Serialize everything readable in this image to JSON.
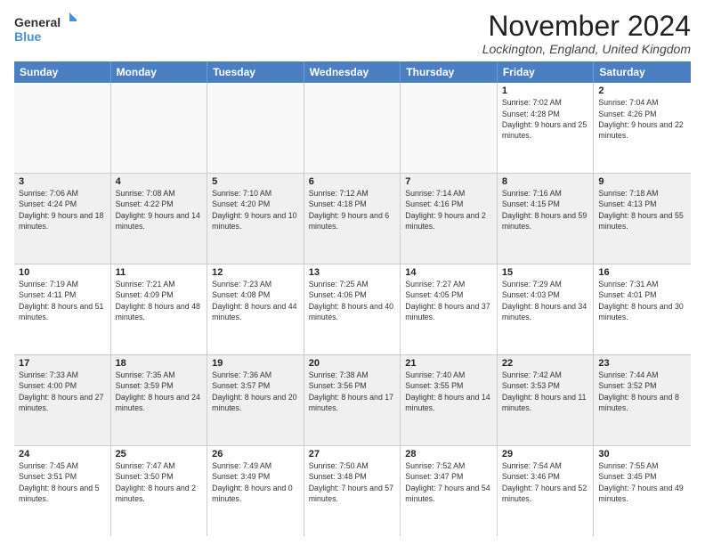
{
  "logo": {
    "line1": "General",
    "line2": "Blue"
  },
  "header": {
    "title": "November 2024",
    "location": "Lockington, England, United Kingdom"
  },
  "weekdays": [
    "Sunday",
    "Monday",
    "Tuesday",
    "Wednesday",
    "Thursday",
    "Friday",
    "Saturday"
  ],
  "rows": [
    [
      {
        "day": "",
        "info": "",
        "empty": true
      },
      {
        "day": "",
        "info": "",
        "empty": true
      },
      {
        "day": "",
        "info": "",
        "empty": true
      },
      {
        "day": "",
        "info": "",
        "empty": true
      },
      {
        "day": "",
        "info": "",
        "empty": true
      },
      {
        "day": "1",
        "info": "Sunrise: 7:02 AM\nSunset: 4:28 PM\nDaylight: 9 hours\nand 25 minutes."
      },
      {
        "day": "2",
        "info": "Sunrise: 7:04 AM\nSunset: 4:26 PM\nDaylight: 9 hours\nand 22 minutes."
      }
    ],
    [
      {
        "day": "3",
        "info": "Sunrise: 7:06 AM\nSunset: 4:24 PM\nDaylight: 9 hours\nand 18 minutes."
      },
      {
        "day": "4",
        "info": "Sunrise: 7:08 AM\nSunset: 4:22 PM\nDaylight: 9 hours\nand 14 minutes."
      },
      {
        "day": "5",
        "info": "Sunrise: 7:10 AM\nSunset: 4:20 PM\nDaylight: 9 hours\nand 10 minutes."
      },
      {
        "day": "6",
        "info": "Sunrise: 7:12 AM\nSunset: 4:18 PM\nDaylight: 9 hours\nand 6 minutes."
      },
      {
        "day": "7",
        "info": "Sunrise: 7:14 AM\nSunset: 4:16 PM\nDaylight: 9 hours\nand 2 minutes."
      },
      {
        "day": "8",
        "info": "Sunrise: 7:16 AM\nSunset: 4:15 PM\nDaylight: 8 hours\nand 59 minutes."
      },
      {
        "day": "9",
        "info": "Sunrise: 7:18 AM\nSunset: 4:13 PM\nDaylight: 8 hours\nand 55 minutes."
      }
    ],
    [
      {
        "day": "10",
        "info": "Sunrise: 7:19 AM\nSunset: 4:11 PM\nDaylight: 8 hours\nand 51 minutes."
      },
      {
        "day": "11",
        "info": "Sunrise: 7:21 AM\nSunset: 4:09 PM\nDaylight: 8 hours\nand 48 minutes."
      },
      {
        "day": "12",
        "info": "Sunrise: 7:23 AM\nSunset: 4:08 PM\nDaylight: 8 hours\nand 44 minutes."
      },
      {
        "day": "13",
        "info": "Sunrise: 7:25 AM\nSunset: 4:06 PM\nDaylight: 8 hours\nand 40 minutes."
      },
      {
        "day": "14",
        "info": "Sunrise: 7:27 AM\nSunset: 4:05 PM\nDaylight: 8 hours\nand 37 minutes."
      },
      {
        "day": "15",
        "info": "Sunrise: 7:29 AM\nSunset: 4:03 PM\nDaylight: 8 hours\nand 34 minutes."
      },
      {
        "day": "16",
        "info": "Sunrise: 7:31 AM\nSunset: 4:01 PM\nDaylight: 8 hours\nand 30 minutes."
      }
    ],
    [
      {
        "day": "17",
        "info": "Sunrise: 7:33 AM\nSunset: 4:00 PM\nDaylight: 8 hours\nand 27 minutes."
      },
      {
        "day": "18",
        "info": "Sunrise: 7:35 AM\nSunset: 3:59 PM\nDaylight: 8 hours\nand 24 minutes."
      },
      {
        "day": "19",
        "info": "Sunrise: 7:36 AM\nSunset: 3:57 PM\nDaylight: 8 hours\nand 20 minutes."
      },
      {
        "day": "20",
        "info": "Sunrise: 7:38 AM\nSunset: 3:56 PM\nDaylight: 8 hours\nand 17 minutes."
      },
      {
        "day": "21",
        "info": "Sunrise: 7:40 AM\nSunset: 3:55 PM\nDaylight: 8 hours\nand 14 minutes."
      },
      {
        "day": "22",
        "info": "Sunrise: 7:42 AM\nSunset: 3:53 PM\nDaylight: 8 hours\nand 11 minutes."
      },
      {
        "day": "23",
        "info": "Sunrise: 7:44 AM\nSunset: 3:52 PM\nDaylight: 8 hours\nand 8 minutes."
      }
    ],
    [
      {
        "day": "24",
        "info": "Sunrise: 7:45 AM\nSunset: 3:51 PM\nDaylight: 8 hours\nand 5 minutes."
      },
      {
        "day": "25",
        "info": "Sunrise: 7:47 AM\nSunset: 3:50 PM\nDaylight: 8 hours\nand 2 minutes."
      },
      {
        "day": "26",
        "info": "Sunrise: 7:49 AM\nSunset: 3:49 PM\nDaylight: 8 hours\nand 0 minutes."
      },
      {
        "day": "27",
        "info": "Sunrise: 7:50 AM\nSunset: 3:48 PM\nDaylight: 7 hours\nand 57 minutes."
      },
      {
        "day": "28",
        "info": "Sunrise: 7:52 AM\nSunset: 3:47 PM\nDaylight: 7 hours\nand 54 minutes."
      },
      {
        "day": "29",
        "info": "Sunrise: 7:54 AM\nSunset: 3:46 PM\nDaylight: 7 hours\nand 52 minutes."
      },
      {
        "day": "30",
        "info": "Sunrise: 7:55 AM\nSunset: 3:45 PM\nDaylight: 7 hours\nand 49 minutes."
      }
    ]
  ]
}
